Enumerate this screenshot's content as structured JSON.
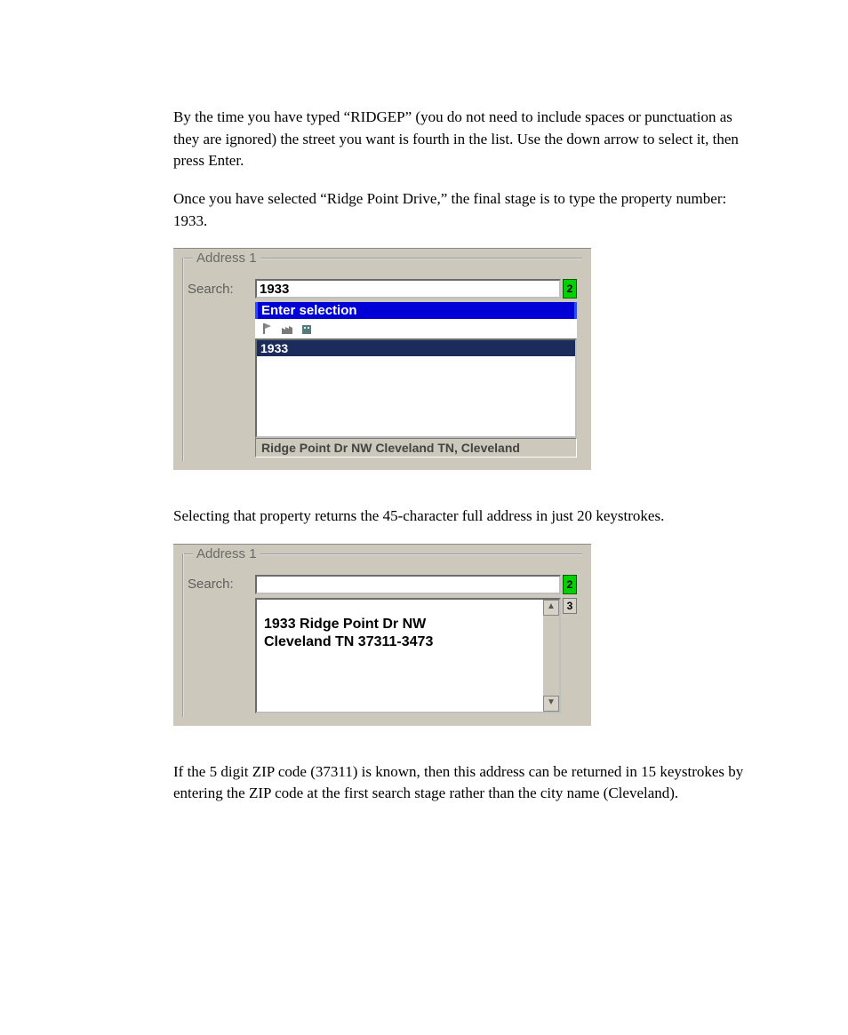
{
  "para1": "By the time you have typed “RIDGEP” (you do not need to include spaces or punctuation as they are ignored) the street you want is fourth in the list. Use the down arrow to select it, then press Enter.",
  "para2": "Once you have selected “Ridge Point Drive,” the final stage is to type the property number: 1933.",
  "para3": "Selecting that property returns the 45-character full address in just 20 keystrokes.",
  "para4": "If the 5 digit ZIP code (37311) is known, then this address can be returned in 15 keystrokes by entering the ZIP code at the first search stage rather than the city name (Cleveland).",
  "box1": {
    "group_label": "Address 1",
    "search_label": "Search:",
    "search_value": "1933",
    "badge": "2",
    "blue_header": "Enter selection",
    "list_selected": "1933",
    "status": "Ridge Point Dr NW Cleveland TN, Cleveland"
  },
  "box2": {
    "group_label": "Address 1",
    "search_label": "Search:",
    "search_value": "",
    "badge_a": "2",
    "badge_b": "3",
    "result_line1": "1933 Ridge Point Dr NW",
    "result_line2": "Cleveland TN  37311-3473"
  }
}
